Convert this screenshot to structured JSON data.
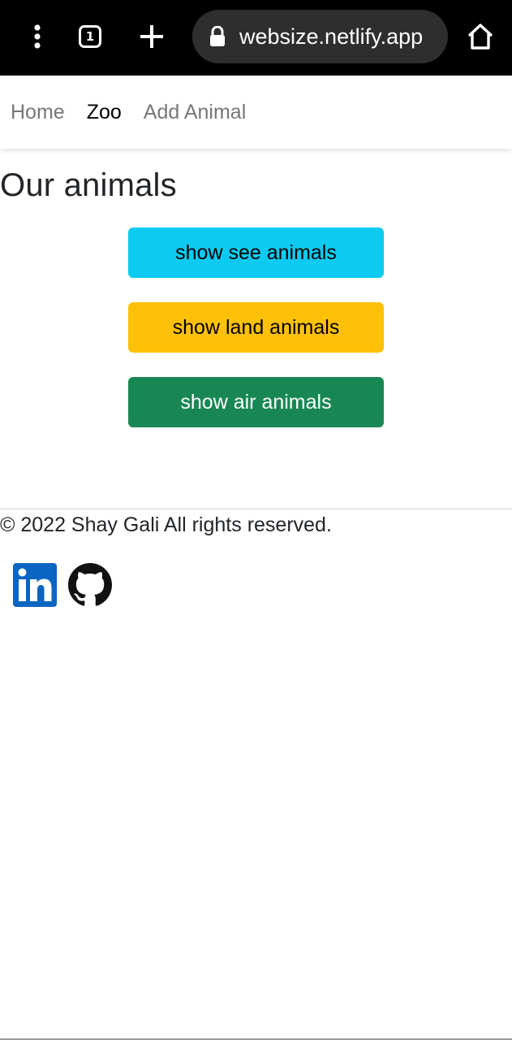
{
  "browser": {
    "url": "websize.netlify.app",
    "tab_count": "1"
  },
  "nav": {
    "items": [
      {
        "label": "Home",
        "active": false
      },
      {
        "label": "Zoo",
        "active": true
      },
      {
        "label": "Add Animal",
        "active": false
      }
    ]
  },
  "main": {
    "title": "Our animals",
    "buttons": [
      {
        "label": "show see animals",
        "bg": "#0dcaf0",
        "color": "#000000"
      },
      {
        "label": "show land animals",
        "bg": "#ffc107",
        "color": "#000000"
      },
      {
        "label": "show air animals",
        "bg": "#198754",
        "color": "#ffffff"
      }
    ]
  },
  "footer": {
    "copyright": "© 2022 Shay Gali All rights reserved.",
    "social": [
      {
        "icon": "linkedin-icon",
        "color": "#0a66c2"
      },
      {
        "icon": "github-icon",
        "color": "#111111"
      }
    ]
  }
}
